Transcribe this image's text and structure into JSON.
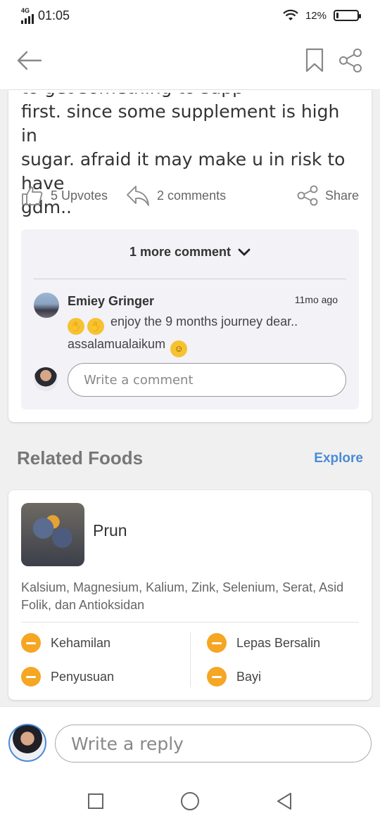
{
  "status": {
    "network": "4G",
    "time": "01:05",
    "battery_text": "12%",
    "battery_level": 0.12
  },
  "toolbar": {
    "back_icon": "arrow-left-icon",
    "bookmark_icon": "bookmark-icon",
    "share_icon": "share-icon"
  },
  "post": {
    "line_partial": "to get something to supp",
    "line1": "first. since some supplement is high in",
    "line2": "sugar. afraid it may make u in risk to have",
    "line3": "gdm..",
    "upvotes": "5 Upvotes",
    "comments": "2 comments",
    "share": "Share"
  },
  "comments": {
    "more_label": "1 more comment",
    "items": [
      {
        "author": "Emiey Gringer",
        "time": "11mo ago",
        "text": "enjoy the 9 months journey dear.. assalamualaikum"
      }
    ],
    "input_placeholder": "Write a comment"
  },
  "related": {
    "title": "Related Foods",
    "explore": "Explore",
    "food": {
      "name": "Prun",
      "description": "Kalsium, Magnesium, Kalium, Zink, Selenium, Serat, Asid Folik, dan Antioksidan",
      "tags": [
        "Kehamilan",
        "Lepas Bersalin",
        "Penyusuan",
        "Bayi"
      ]
    }
  },
  "reply": {
    "placeholder": "Write a reply"
  },
  "colors": {
    "accent": "#4a8ad6",
    "warning": "#f5a623"
  }
}
